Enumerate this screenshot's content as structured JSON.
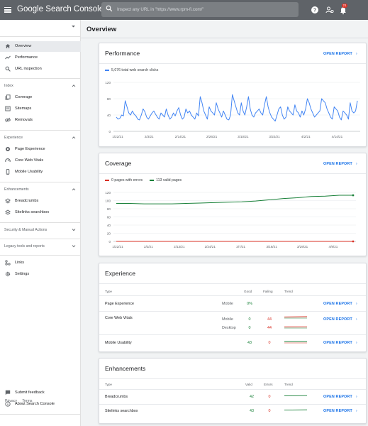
{
  "app": {
    "name": "Google Search Console",
    "search_placeholder": "Inspect any URL in \"https://www.rpm-fi.com/\"",
    "notification_count": "21"
  },
  "sidebar": {
    "top_items": [
      {
        "label": "Overview",
        "icon": "home-icon",
        "active": true
      },
      {
        "label": "Performance",
        "icon": "trending-icon"
      },
      {
        "label": "URL inspection",
        "icon": "search-icon"
      }
    ],
    "sections": [
      {
        "title": "Index",
        "items": [
          {
            "label": "Coverage",
            "icon": "document-copy-icon"
          },
          {
            "label": "Sitemaps",
            "icon": "sitemap-icon"
          },
          {
            "label": "Removals",
            "icon": "eye-off-icon"
          }
        ]
      },
      {
        "title": "Experience",
        "items": [
          {
            "label": "Page Experience",
            "icon": "experience-icon"
          },
          {
            "label": "Core Web Vitals",
            "icon": "speed-icon"
          },
          {
            "label": "Mobile Usability",
            "icon": "phone-icon"
          }
        ]
      },
      {
        "title": "Enhancements",
        "items": [
          {
            "label": "Breadcrumbs",
            "icon": "layers-icon"
          },
          {
            "label": "Sitelinks searchbox",
            "icon": "layers-icon"
          }
        ]
      },
      {
        "title": "Security & Manual Actions",
        "items": []
      },
      {
        "title": "Legacy tools and reports",
        "items": []
      }
    ],
    "bottom_items": [
      {
        "label": "Links",
        "icon": "links-icon"
      },
      {
        "label": "Settings",
        "icon": "gear-icon"
      }
    ],
    "footer_items": [
      {
        "label": "Submit feedback",
        "icon": "feedback-icon"
      },
      {
        "label": "About Search Console",
        "icon": "info-icon"
      }
    ],
    "footer_links": [
      "Privacy",
      "Terms"
    ]
  },
  "main": {
    "title": "Overview",
    "open_report": "OPEN REPORT",
    "performance": {
      "title": "Performance",
      "legend": "5,076 total web search clicks",
      "color": "#4285f4"
    },
    "coverage": {
      "title": "Coverage",
      "legend_errors": "0 pages with errors",
      "legend_valid": "113 valid pages",
      "error_color": "#d93025",
      "valid_color": "#188038"
    },
    "experience": {
      "title": "Experience",
      "headers": {
        "type": "Type",
        "good": "Good",
        "failing": "Failing",
        "trend": "Trend"
      },
      "rows": [
        {
          "type": "Page Experience",
          "device": "Mobile",
          "good": "0%",
          "failing": ""
        },
        {
          "type": "Core Web Vitals",
          "device": "Mobile",
          "good": "0",
          "failing": "44"
        },
        {
          "type": "",
          "device": "Desktop",
          "good": "0",
          "failing": "44"
        },
        {
          "type": "Mobile Usability",
          "device": "",
          "good": "43",
          "failing": "0"
        }
      ]
    },
    "enhancements": {
      "title": "Enhancements",
      "headers": {
        "type": "Type",
        "valid": "Valid",
        "errors": "Errors",
        "trend": "Trend"
      },
      "rows": [
        {
          "type": "Breadcrumbs",
          "valid": "42",
          "errors": "0"
        },
        {
          "type": "Sitelinks searchbox",
          "valid": "43",
          "errors": "0"
        }
      ]
    }
  },
  "chart_data": [
    {
      "type": "line",
      "ylim": [
        0,
        120
      ],
      "yticks": [
        0,
        40,
        80,
        120
      ],
      "xticks": [
        "1/22/21",
        "2/3/21",
        "2/14/21",
        "2/26/21",
        "3/10/21",
        "3/22/21",
        "4/2/21",
        "4/14/21"
      ],
      "series": [
        {
          "name": "5,076 total web search clicks",
          "values": [
            35,
            30,
            32,
            40,
            38,
            75,
            60,
            45,
            40,
            50,
            42,
            38,
            30,
            28,
            40,
            55,
            48,
            35,
            30,
            38,
            45,
            50,
            42,
            35,
            30,
            45,
            40,
            35,
            55,
            40,
            30,
            35,
            45,
            38,
            50,
            58,
            40,
            30,
            35,
            55,
            45,
            50,
            40,
            35,
            30,
            45,
            38,
            85,
            70,
            50,
            40,
            30,
            60,
            50,
            45,
            40,
            70,
            55,
            45,
            35,
            50,
            40,
            30,
            28,
            40,
            90,
            75,
            60,
            45,
            40,
            70,
            50,
            40,
            60,
            85,
            55,
            40,
            35,
            45,
            50,
            55,
            45,
            40,
            65,
            85,
            60,
            45,
            35,
            30,
            25,
            40,
            55,
            60,
            40,
            30,
            35,
            60,
            50,
            45,
            40,
            65,
            50,
            45,
            35,
            50,
            40,
            55,
            80,
            70,
            55,
            45,
            35,
            40,
            45,
            50,
            80,
            75,
            70,
            55,
            45,
            35,
            30,
            60,
            55,
            50,
            35,
            28,
            50,
            45,
            40,
            30,
            70,
            50,
            45,
            50,
            75
          ]
        }
      ]
    },
    {
      "type": "line",
      "ylim": [
        0,
        120
      ],
      "yticks": [
        0,
        20,
        40,
        60,
        80,
        100,
        120
      ],
      "xticks": [
        "1/22/21",
        "2/2/21",
        "2/13/21",
        "2/24/21",
        "3/7/21",
        "3/18/21",
        "3/29/21",
        "4/9/21"
      ],
      "series": [
        {
          "name": "0 pages with errors",
          "values": [
            0,
            0,
            0,
            0,
            0,
            0,
            0,
            0,
            0,
            0,
            0,
            0
          ]
        },
        {
          "name": "113 valid pages",
          "values": [
            93,
            93,
            92,
            92,
            92,
            93,
            94,
            95,
            96,
            97,
            99,
            102,
            105,
            107,
            110,
            111,
            113,
            113
          ]
        }
      ]
    }
  ]
}
